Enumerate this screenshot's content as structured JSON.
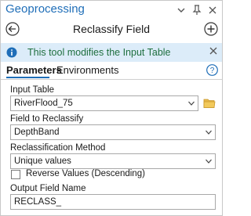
{
  "titlebar": {
    "title": "Geoprocessing",
    "icons": [
      "chevron-down-icon",
      "pin-icon",
      "close-icon"
    ]
  },
  "tool": {
    "title": "Reclassify Field",
    "back_icon": "back-arrow-icon",
    "add_icon": "add-circle-icon"
  },
  "info": {
    "text": "This tool modifies the Input Table",
    "icon": "info-icon",
    "close_icon": "close-icon",
    "bg_color": "#dcecf9"
  },
  "tabs": [
    {
      "label": "Parameters",
      "active": true
    },
    {
      "label": "Environments",
      "active": false
    }
  ],
  "params": {
    "input_table": {
      "label": "Input Table",
      "value": "RiverFlood_75"
    },
    "field": {
      "label": "Field to Reclassify",
      "value": "DepthBand"
    },
    "method": {
      "label": "Reclassification Method",
      "value": "Unique values"
    },
    "reverse": {
      "label": "Reverse Values (Descending)",
      "checked": false
    },
    "output": {
      "label": "Output Field Name",
      "value": "RECLASS_"
    }
  },
  "colors": {
    "accent": "#1f6eb8",
    "info_text": "#1f6f3f"
  }
}
